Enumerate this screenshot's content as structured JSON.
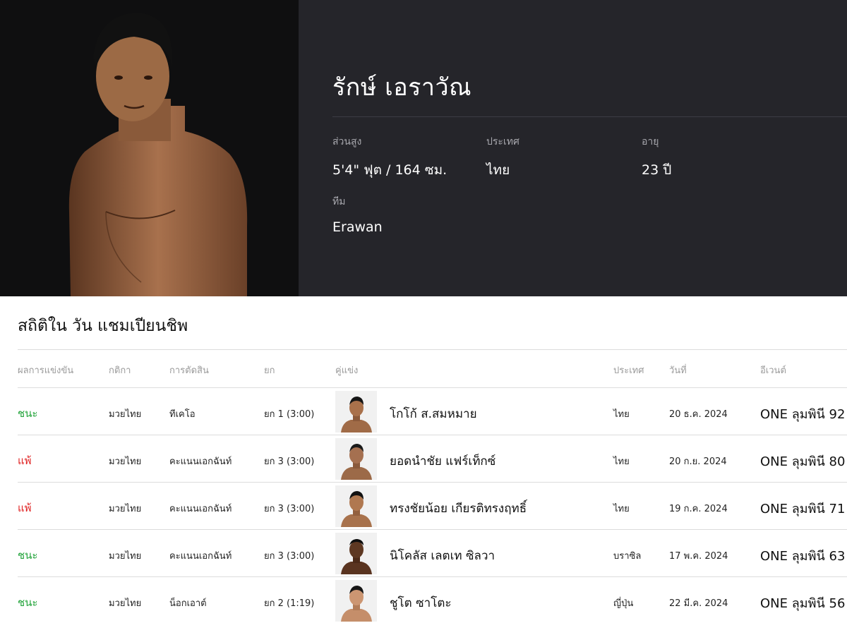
{
  "profile": {
    "name": "รักษ์ เอราวัณ",
    "height_label": "ส่วนสูง",
    "height_value": "5'4\" ฟุต / 164 ซม.",
    "country_label": "ประเทศ",
    "country_value": "ไทย",
    "age_label": "อายุ",
    "age_value": "23 ปี",
    "team_label": "ทีม",
    "team_value": "Erawan"
  },
  "stats": {
    "title": "สถิติใน วัน แชมเปียนชิพ",
    "columns": {
      "result": "ผลการแข่งขัน",
      "rules": "กติกา",
      "method": "การตัดสิน",
      "round": "ยก",
      "opponent": "คู่แข่ง",
      "country": "ประเทศ",
      "date": "วันที่",
      "event": "อีเวนต์"
    },
    "rows": [
      {
        "result": "ชนะ",
        "rules": "มวยไทย",
        "method": "ทีเคโอ",
        "round": "ยก 1 (3:00)",
        "opponent": "โกโก้ ส.สมหมาย",
        "country": "ไทย",
        "date": "20 ธ.ค. 2024",
        "event": "ONE ลุมพินี 92"
      },
      {
        "result": "แพ้",
        "rules": "มวยไทย",
        "method": "คะแนนเอกฉันท์",
        "round": "ยก 3 (3:00)",
        "opponent": "ยอดนำชัย แฟร์เท็กซ์",
        "country": "ไทย",
        "date": "20 ก.ย. 2024",
        "event": "ONE ลุมพินี 80"
      },
      {
        "result": "แพ้",
        "rules": "มวยไทย",
        "method": "คะแนนเอกฉันท์",
        "round": "ยก 3 (3:00)",
        "opponent": "ทรงชัยน้อย เกียรติทรงฤทธิ์",
        "country": "ไทย",
        "date": "19 ก.ค. 2024",
        "event": "ONE ลุมพินี 71"
      },
      {
        "result": "ชนะ",
        "rules": "มวยไทย",
        "method": "คะแนนเอกฉันท์",
        "round": "ยก 3 (3:00)",
        "opponent": "นิโคลัส เลตเท ซิลวา",
        "country": "บราซิล",
        "date": "17 พ.ค. 2024",
        "event": "ONE ลุมพินี 63"
      },
      {
        "result": "ชนะ",
        "rules": "มวยไทย",
        "method": "น็อกเอาต์",
        "round": "ยก 2 (1:19)",
        "opponent": "ชูโต ซาโตะ",
        "country": "ญี่ปุ่น",
        "date": "22 มี.ค. 2024",
        "event": "ONE ลุมพินี 56"
      }
    ]
  },
  "colors": {
    "hero_bg": "#25252a",
    "photo_bg": "#0f0f10",
    "win": "#23a43b",
    "loss": "#e02424"
  }
}
